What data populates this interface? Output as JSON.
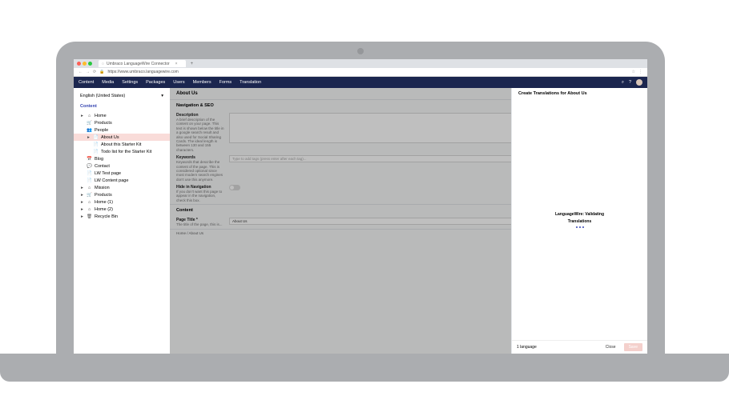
{
  "browser": {
    "tab_title": "Umbraco LanguageWire Connector",
    "url": "https://www.umbraco.languagewire.com"
  },
  "topnav": {
    "items": [
      "Content",
      "Media",
      "Settings",
      "Packages",
      "Users",
      "Members",
      "Forms",
      "Translation"
    ]
  },
  "sidebar": {
    "language": "English (United States)",
    "heading": "Content",
    "tree": {
      "home": "Home",
      "products": "Products",
      "people": "People",
      "about_us": "About Us",
      "about_kit": "About this Starter Kit",
      "todo_kit": "Todo list for the Starter Kit",
      "blog": "Blog",
      "contact": "Contact",
      "test_page": "LW Test page",
      "content_page": "LW Content page",
      "mission": "Mission",
      "products_dup": "Products",
      "home2": "Home (1)",
      "home3": "Home (2)",
      "recycle": "Recycle Bin"
    }
  },
  "main": {
    "tab": "About Us",
    "nav_seo": "Navigation & SEO",
    "description": {
      "title": "Description",
      "help": "A brief description of the content on your page. This text is shown below the title in a google search result and also used for Social Sharing Cards. The ideal length is between 130 and 155 characters."
    },
    "keywords": {
      "title": "Keywords",
      "help": "Keywords that describe the content of the page. This is considered optional since most modern search engines don't use this anymore.",
      "placeholder": "Type to add tags (press enter after each tag)..."
    },
    "hide_nav": {
      "title": "Hide in Navigation",
      "help": "If you don't want this page to appear in the navigation, check this box."
    },
    "content_section": "Content",
    "page_title": {
      "title": "Page Title *",
      "help": "The title of the page, this is...",
      "value": "About Us"
    },
    "breadcrumbs": "Home / About Us"
  },
  "panel": {
    "heading": "Create Translations for About Us",
    "status_line1": "LanguageWire: Validating",
    "status_line2": "Translations",
    "footer_info": "1 language",
    "close": "Close",
    "save": "Save"
  }
}
